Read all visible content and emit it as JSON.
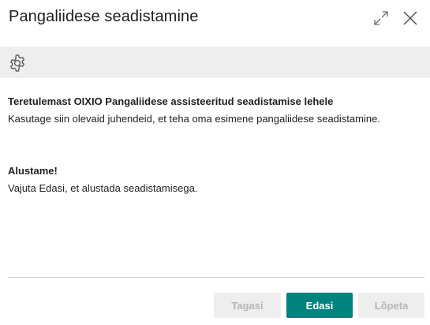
{
  "dialog": {
    "title": "Pangaliidese seadistamine",
    "window_controls": {
      "expand_icon": "expand-diagonal-arrows-icon",
      "close_icon": "close-x-icon"
    }
  },
  "toolbar": {
    "settings_icon": "gear-icon"
  },
  "welcome": {
    "heading": "Teretulemast OIXIO Pangaliidese assisteeritud seadistamise lehele",
    "text": "Kasutage siin olevaid juhendeid, et teha oma esimene pangaliidese seadistamine."
  },
  "start": {
    "heading": "Alustame!",
    "text": "Vajuta Edasi, et alustada seadistamisega."
  },
  "actions": {
    "back_label": "Tagasi",
    "next_label": "Edasi",
    "finish_label": "Lõpeta",
    "back_enabled": false,
    "next_enabled": true,
    "finish_enabled": false
  },
  "colors": {
    "primary": "#00827F",
    "toolbar_bg": "#EEEEEE",
    "disabled_text": "#B6B6B6"
  }
}
